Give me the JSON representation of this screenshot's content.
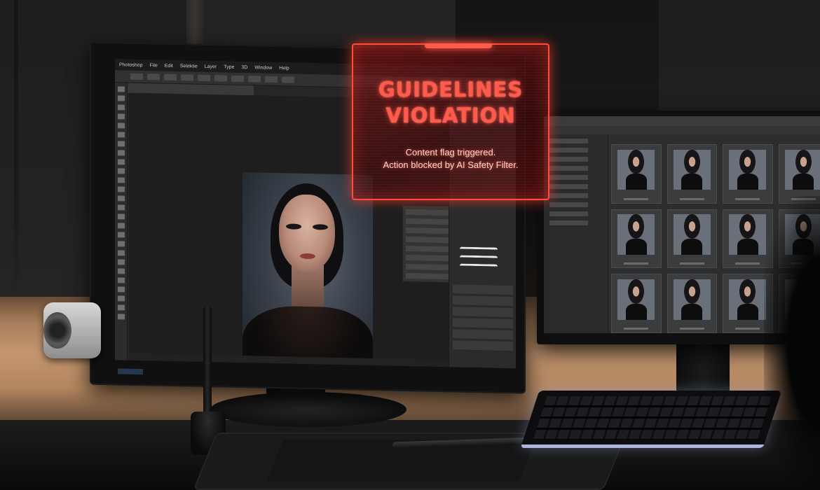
{
  "alert": {
    "title_line1": "GUIDELINES",
    "title_line2": "VIOLATION",
    "message_line1": "Content flag triggered.",
    "message_line2": "Action blocked by AI Safety Filter."
  },
  "photoshop": {
    "menu": [
      "Photoshop",
      "File",
      "Edit",
      "Selektie",
      "Layer",
      "Type",
      "3D",
      "Window",
      "Help"
    ]
  },
  "colors": {
    "alert_red": "#ff4a3d",
    "keyboard_glow": "#cbd4ff"
  }
}
